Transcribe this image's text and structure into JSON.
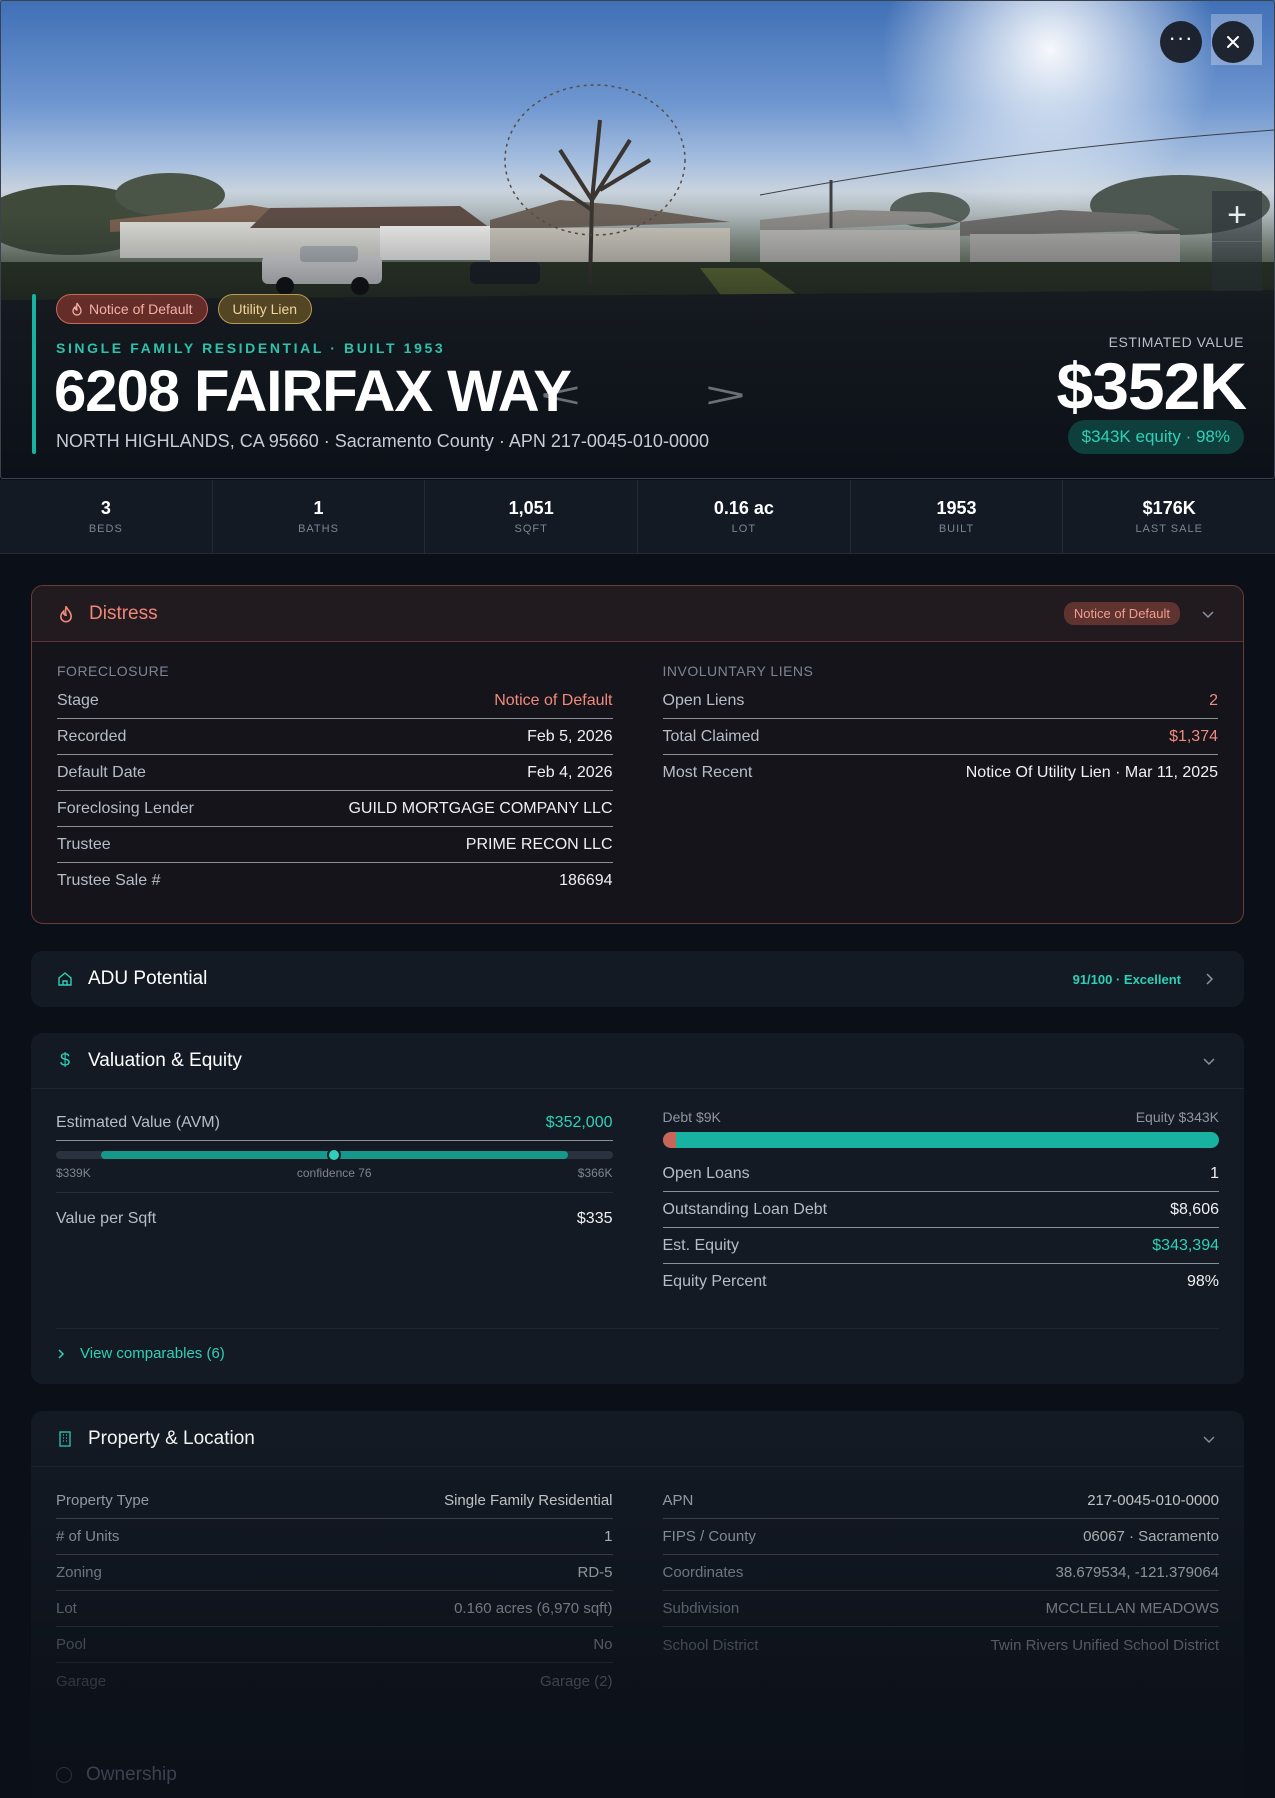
{
  "hero": {
    "chips": [
      "Notice of Default",
      "Utility Lien"
    ],
    "subtitle": "SINGLE FAMILY RESIDENTIAL · BUILT 1953",
    "title": "6208 FAIRFAX WAY",
    "address": "NORTH HIGHLANDS, CA 95660 · Sacramento County · APN 217-0045-010-0000",
    "estimated_label": "ESTIMATED VALUE",
    "estimated_value": "$352K",
    "equity_pill": "$343K equity · 98%",
    "more_icon": "ellipsis-icon",
    "close_icon": "close-icon"
  },
  "stats": [
    {
      "value": "3",
      "label": "BEDS"
    },
    {
      "value": "1",
      "label": "BATHS"
    },
    {
      "value": "1,051",
      "label": "SQFT"
    },
    {
      "value": "0.16 ac",
      "label": "LOT"
    },
    {
      "value": "1953",
      "label": "BUILT"
    },
    {
      "value": "$176K",
      "label": "LAST SALE"
    }
  ],
  "distress": {
    "title": "Distress",
    "badge": "Notice of Default",
    "foreclosure_heading": "FORECLOSURE",
    "foreclosure": [
      {
        "k": "Stage",
        "v": "Notice of Default"
      },
      {
        "k": "Recorded",
        "v": "Feb 5, 2026"
      },
      {
        "k": "Default Date",
        "v": "Feb 4, 2026"
      },
      {
        "k": "Foreclosing Lender",
        "v": "GUILD MORTGAGE COMPANY LLC"
      },
      {
        "k": "Trustee",
        "v": "PRIME RECON LLC"
      },
      {
        "k": "Trustee Sale #",
        "v": "186694"
      }
    ],
    "liens_heading": "INVOLUNTARY LIENS",
    "liens": [
      {
        "k": "Open Liens",
        "v": "2"
      },
      {
        "k": "Total Claimed",
        "v": "$1,374"
      },
      {
        "k": "Most Recent",
        "v": "Notice Of Utility Lien · Mar 11, 2025"
      }
    ]
  },
  "adu": {
    "title": "ADU Potential",
    "score": "91/100 · Excellent"
  },
  "valuation": {
    "title": "Valuation & Equity",
    "avm_label": "Estimated Value (AVM)",
    "avm_value": "$352,000",
    "range_low": "$339K",
    "range_high": "$366K",
    "confidence_label": "confidence 76",
    "confidence_fraction": 0.5,
    "per_sqft_label": "Value per Sqft",
    "per_sqft_value": "$335",
    "debt_label": "Debt $9K",
    "equity_label": "Equity $343K",
    "debt_fraction": 0.025,
    "rows": [
      {
        "k": "Open Loans",
        "v": "1"
      },
      {
        "k": "Outstanding Loan Debt",
        "v": "$8,606"
      },
      {
        "k": "Est. Equity",
        "v": "$343,394"
      },
      {
        "k": "Equity Percent",
        "v": "98%"
      }
    ],
    "comparables_link": "View comparables (6)"
  },
  "property": {
    "title": "Property & Location",
    "left": [
      {
        "k": "Property Type",
        "v": "Single Family Residential"
      },
      {
        "k": "# of Units",
        "v": "1"
      },
      {
        "k": "Zoning",
        "v": "RD-5"
      },
      {
        "k": "Lot",
        "v": "0.160 acres (6,970 sqft)"
      },
      {
        "k": "Pool",
        "v": "No"
      },
      {
        "k": "Garage",
        "v": "Garage (2)"
      }
    ],
    "right": [
      {
        "k": "APN",
        "v": "217-0045-010-0000"
      },
      {
        "k": "FIPS / County",
        "v": "06067 · Sacramento"
      },
      {
        "k": "Coordinates",
        "v": "38.679534, -121.379064"
      },
      {
        "k": "Subdivision",
        "v": "MCCLELLAN MEADOWS"
      },
      {
        "k": "School District",
        "v": "Twin Rivers Unified School District"
      }
    ]
  },
  "ownership": {
    "title": "Ownership"
  },
  "colors": {
    "accent": "#17b3a0",
    "distress": "#f08678",
    "background": "#0b1018"
  }
}
